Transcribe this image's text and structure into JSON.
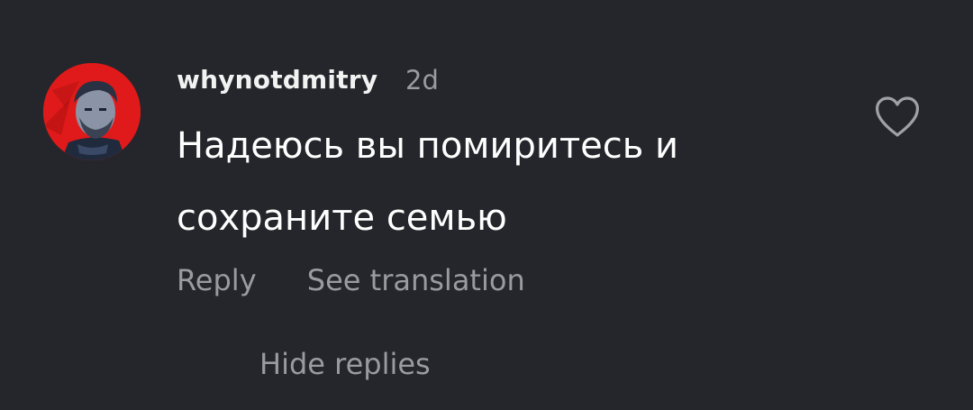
{
  "comment": {
    "username": "whynotdmitry",
    "timestamp": "2d",
    "text": "Надеюсь вы помиритесь и сохраните семью",
    "avatar_icon": "user-avatar-icon",
    "like_icon": "heart-outline-icon"
  },
  "actions": {
    "reply_label": "Reply",
    "translate_label": "See translation",
    "hide_replies_label": "Hide replies"
  },
  "colors": {
    "background": "#25262b",
    "text_primary": "#ffffff",
    "text_secondary": "#9a9ba0",
    "avatar_background": "#e01a1a"
  }
}
